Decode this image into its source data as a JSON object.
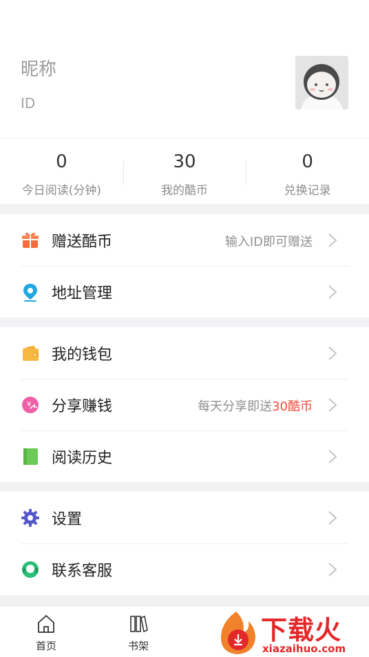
{
  "profile": {
    "nickname": "昵称",
    "id_label": "ID"
  },
  "stats": [
    {
      "value": "0",
      "label": "今日阅读(分钟)"
    },
    {
      "value": "30",
      "label": "我的酷币"
    },
    {
      "value": "0",
      "label": "兑换记录"
    }
  ],
  "menu": {
    "gift_coins": {
      "label": "赠送酷币",
      "hint": "输入ID即可赠送"
    },
    "address": {
      "label": "地址管理"
    },
    "wallet": {
      "label": "我的钱包"
    },
    "share_earn": {
      "label": "分享赚钱",
      "hint_prefix": "每天分享即送",
      "hint_highlight": "30酷币"
    },
    "history": {
      "label": "阅读历史"
    },
    "settings": {
      "label": "设置"
    },
    "support": {
      "label": "联系客服"
    }
  },
  "tabbar": {
    "home": "首页",
    "bookshelf": "书架"
  },
  "watermark": {
    "title": "下载火",
    "subtitle": "xiazaihuo.com"
  },
  "colors": {
    "accent_red": "#ee4b3a",
    "gift_orange": "#f36c3b",
    "location_blue": "#22a7e0",
    "wallet_yellow": "#f5b942",
    "share_pink": "#ef5fa7",
    "history_green": "#6cc957",
    "settings_indigo": "#5457c9",
    "support_green": "#2bbf78"
  }
}
